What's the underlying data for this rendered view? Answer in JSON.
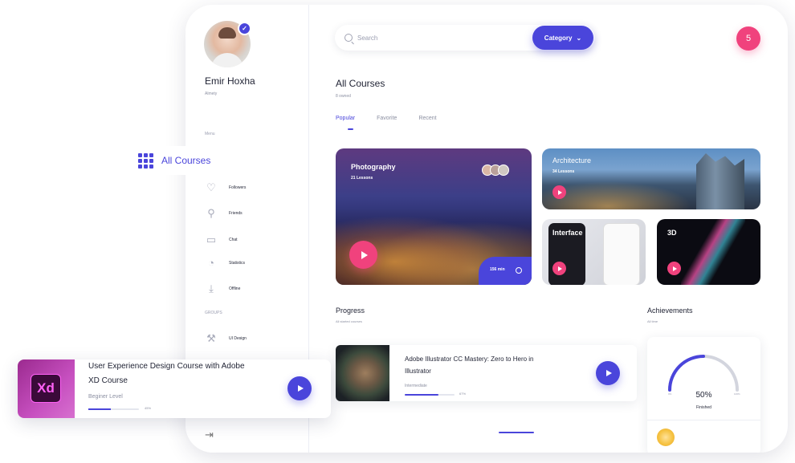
{
  "profile": {
    "name": "Emir Hoxha",
    "role": "Almety"
  },
  "sidebar": {
    "menu_label": "Menu",
    "active_item": "All Courses",
    "items": [
      {
        "label": "Followers",
        "icon": "heart-icon"
      },
      {
        "label": "Friends",
        "icon": "friends-icon"
      },
      {
        "label": "Chat",
        "icon": "chat-icon"
      },
      {
        "label": "Statistics",
        "icon": "pie-chart-icon"
      },
      {
        "label": "Offline",
        "icon": "download-icon"
      }
    ],
    "groups_label": "GROUPS",
    "groups": [
      {
        "label": "UI Design",
        "icon": "tools-icon"
      }
    ],
    "logout_icon": "logout-icon"
  },
  "search": {
    "placeholder": "Search"
  },
  "category_button": {
    "label": "Category"
  },
  "notifications": {
    "count": "5"
  },
  "header": {
    "title": "All Courses",
    "subtitle": "8 owned"
  },
  "tabs": [
    {
      "label": "Popular",
      "active": true
    },
    {
      "label": "Favorite",
      "active": false
    },
    {
      "label": "Recent",
      "active": false
    }
  ],
  "courses": [
    {
      "title": "Photography",
      "lessons": "21 Lessons",
      "duration": "156 min"
    },
    {
      "title": "Architecture",
      "lessons": "34 Lessons"
    },
    {
      "title": "Interface"
    },
    {
      "title": "3D"
    }
  ],
  "progress": {
    "title": "Progress",
    "subtitle": "All started courses",
    "course": {
      "title": "Adobe Illustrator CC Mastery: Zero to Hero in Illustrator",
      "level": "Intermediate",
      "percent_label": "67%",
      "percent": 67
    }
  },
  "achievements": {
    "title": "Achievements",
    "subtitle": "All time",
    "value": "50%",
    "label": "Finished",
    "percent": 50,
    "range_min": "0%",
    "range_max": "100%"
  },
  "floating_course": {
    "title": "User Experience Design Course with Adobe XD Course",
    "level": "Beginer Level",
    "percent_label": "45%",
    "percent": 45,
    "thumb_text": "Xd"
  },
  "colors": {
    "accent": "#4a45db",
    "pink": "#f0427d"
  }
}
